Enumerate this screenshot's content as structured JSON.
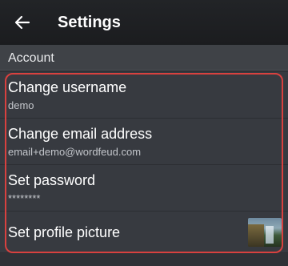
{
  "appbar": {
    "back_icon": "arrow-left-icon",
    "title": "Settings"
  },
  "section": {
    "title": "Account"
  },
  "items": [
    {
      "title": "Change username",
      "subtitle": "demo"
    },
    {
      "title": "Change email address",
      "subtitle": "email+demo@wordfeud.com"
    },
    {
      "title": "Set password",
      "subtitle": "********"
    },
    {
      "title": "Set profile picture",
      "thumbnail_icon": "profile-picture-thumbnail"
    }
  ],
  "colors": {
    "appbar_bg": "#1b1c1f",
    "section_bg": "#3f4247",
    "item_bg": "#373a40",
    "highlight_border": "#d8413f",
    "text_primary": "#ffffff",
    "text_secondary": "#c3c6cb"
  }
}
